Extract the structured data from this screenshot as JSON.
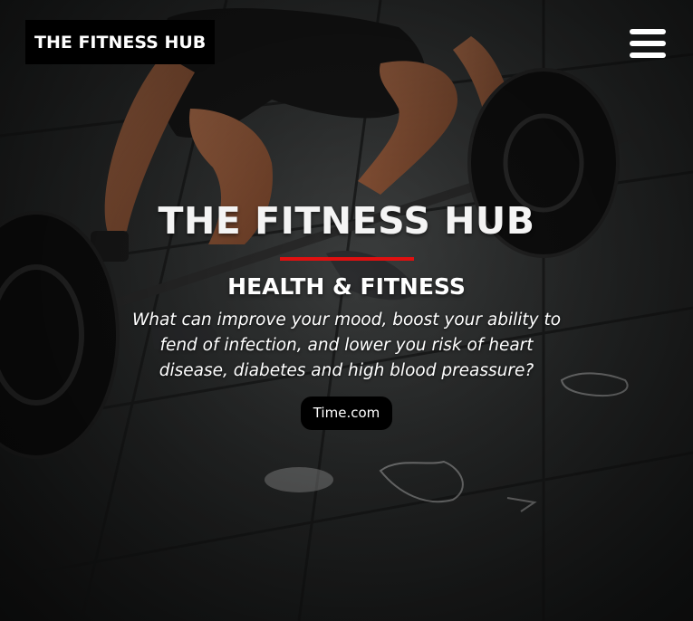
{
  "header": {
    "logo_text": "THE FITNESS HUB",
    "menu_icon": "hamburger-menu-icon"
  },
  "hero": {
    "title": "THE FITNESS HUB",
    "subtitle": "HEALTH & FITNESS",
    "description": "What can improve your mood, boost your ability to fend of infection, and lower you risk of heart disease, diabetes and high blood preassure?",
    "source_button": "Time.com",
    "accent_color": "#e01010",
    "background_image": "person deadlifting a barbell on gym floor"
  }
}
